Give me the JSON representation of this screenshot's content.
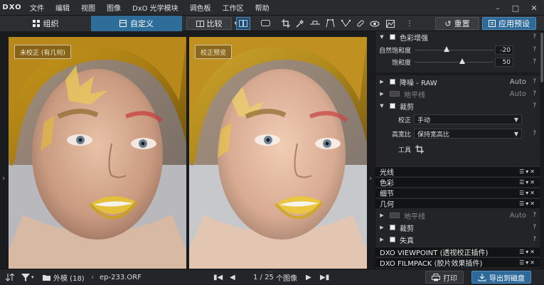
{
  "app": {
    "logo": "DXO"
  },
  "menu": [
    "文件",
    "编辑",
    "视图",
    "图像",
    "DxO 光学模块",
    "调色板",
    "工作区",
    "帮助"
  ],
  "tabs": {
    "organize": "组织",
    "customize": "自定义"
  },
  "toolbar": {
    "compare": "比较",
    "reset": "重置",
    "apply_preset": "应用预设"
  },
  "images": {
    "left_label": "未校正 (有几何)",
    "right_label": "校正预览"
  },
  "panel": {
    "color_enhance": {
      "title": "色彩增强",
      "vibrancy_label": "自然饱和度",
      "vibrancy_value": "-20",
      "vibrancy_level": 0.4,
      "saturation_label": "饱和度",
      "saturation_value": "50",
      "saturation_level": 0.6
    },
    "noise": {
      "title": "降噪 - RAW",
      "mode": "Auto"
    },
    "horizon": {
      "title": "地平线",
      "mode": "Auto"
    },
    "crop": {
      "title": "裁剪",
      "correction_label": "校正",
      "correction_value": "手动",
      "ratio_label": "高宽比",
      "ratio_value": "保持宽高比",
      "tool_label": "工具"
    },
    "sections": [
      "光线",
      "色彩",
      "细节",
      "几何"
    ],
    "geo_horizon": {
      "title": "地平线",
      "mode": "Auto"
    },
    "geo_crop": {
      "title": "裁剪"
    },
    "geo_distortion": {
      "title": "失真"
    },
    "plugins": [
      "DXO VIEWPOINT (透视校正插件)",
      "DXO FILMPACK (胶片效果插件)"
    ],
    "help": "?"
  },
  "statusbar": {
    "folder": "外模 (18)",
    "file": "ep-233.ORF",
    "counter": "1 / 25",
    "counter_suffix": "个图像",
    "print": "打印",
    "export": "导出到磁盘"
  }
}
